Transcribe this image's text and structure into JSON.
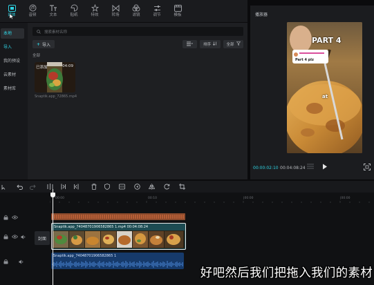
{
  "toolbar": {
    "tools": [
      {
        "label": "媒体",
        "icon": "media-icon",
        "active": true
      },
      {
        "label": "音频",
        "icon": "audio-icon"
      },
      {
        "label": "文本",
        "icon": "text-icon"
      },
      {
        "label": "贴纸",
        "icon": "sticker-icon"
      },
      {
        "label": "特效",
        "icon": "effects-icon"
      },
      {
        "label": "转场",
        "icon": "transition-icon"
      },
      {
        "label": "滤镜",
        "icon": "filter-icon"
      },
      {
        "label": "调节",
        "icon": "adjust-icon"
      },
      {
        "label": "模板",
        "icon": "template-icon"
      }
    ]
  },
  "leftnav": {
    "items": [
      {
        "label": "本地",
        "state": "active"
      },
      {
        "label": "导入",
        "state": "accent"
      },
      {
        "label": "我的预设",
        "state": ""
      },
      {
        "label": "云素材",
        "state": ""
      },
      {
        "label": "素材库",
        "state": ""
      }
    ]
  },
  "media": {
    "search_placeholder": "搜索素材名称",
    "import_label": "导入",
    "sort_label": "排序",
    "filter_label": "全部",
    "section_label": "全部",
    "item": {
      "badge": "已添加",
      "duration": "04:09",
      "filename": "Snaptik.app_72865.mp4"
    }
  },
  "player": {
    "title": "播放器",
    "video_overlay_title": "PART 4",
    "video_overlay_comment": "Part 4 plz",
    "video_caption": "at",
    "current_time": "00:00:02:10",
    "total_time": "00:04:08:24"
  },
  "timeline": {
    "ruler_ticks": [
      "00:00",
      "00:10",
      "|00:00",
      "|00:00"
    ],
    "cover_label": "封面",
    "video_clip_label": "Snaptik.app_74048701906582865 1.mp4   00:04:08:24",
    "audio_clip_label": "Snaptik.app_74048701906582865 1"
  },
  "subtitle": "好吧然后我们把拖入我们的素材",
  "colors": {
    "accent": "#2fd3e3",
    "video_clip": "#1d4b52",
    "audio_clip": "#163a6b",
    "orange_clip": "#c8663a"
  }
}
